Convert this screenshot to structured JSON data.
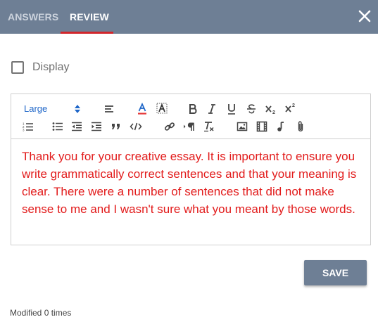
{
  "tabs": {
    "answers_label": "ANSWERS",
    "review_label": "REVIEW",
    "active": "review"
  },
  "display": {
    "label": "Display",
    "checked": false
  },
  "toolbar": {
    "font_size_value": "Large",
    "icons": [
      "sort-arrows-icon",
      "align-icon",
      "text-color-icon",
      "background-color-icon",
      "bold-icon",
      "italic-icon",
      "underline-icon",
      "strikethrough-icon",
      "subscript-icon",
      "superscript-icon",
      "ordered-list-icon",
      "unordered-list-icon",
      "outdent-icon",
      "indent-icon",
      "blockquote-icon",
      "code-icon",
      "link-icon",
      "text-direction-icon",
      "clear-format-icon",
      "image-icon",
      "video-icon",
      "audio-icon",
      "attachment-icon"
    ]
  },
  "editor": {
    "content": "Thank you for your creative essay. It is important to ensure you write grammatically correct sentences and that your meaning is clear. There were a number of sentences that did not make sense to me and I wasn't sure what you meant by those words."
  },
  "colors": {
    "header": "#6e7f95",
    "accent": "#d2262b",
    "content_text": "#e21b1b",
    "link_blue": "#1e66c8"
  },
  "actions": {
    "save_label": "SAVE"
  },
  "footer": {
    "modified_text": "Modified 0 times"
  }
}
